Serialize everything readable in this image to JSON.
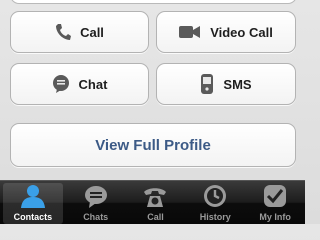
{
  "actions": {
    "call_label": "Call",
    "video_call_label": "Video Call",
    "chat_label": "Chat",
    "sms_label": "SMS",
    "view_profile_label": "View Full Profile"
  },
  "tabbar": {
    "items": [
      {
        "label": "Contacts",
        "icon": "person-icon",
        "active": true
      },
      {
        "label": "Chats",
        "icon": "speech-bubble-icon",
        "active": false
      },
      {
        "label": "Call",
        "icon": "rotary-phone-icon",
        "active": false
      },
      {
        "label": "History",
        "icon": "clock-icon",
        "active": false
      },
      {
        "label": "My Info",
        "icon": "checkmark-shield-icon",
        "active": false
      }
    ]
  },
  "colors": {
    "profile_text": "#3c5a86",
    "icon_gray": "#5a5a5a",
    "tabbar_bg": "#141414"
  }
}
